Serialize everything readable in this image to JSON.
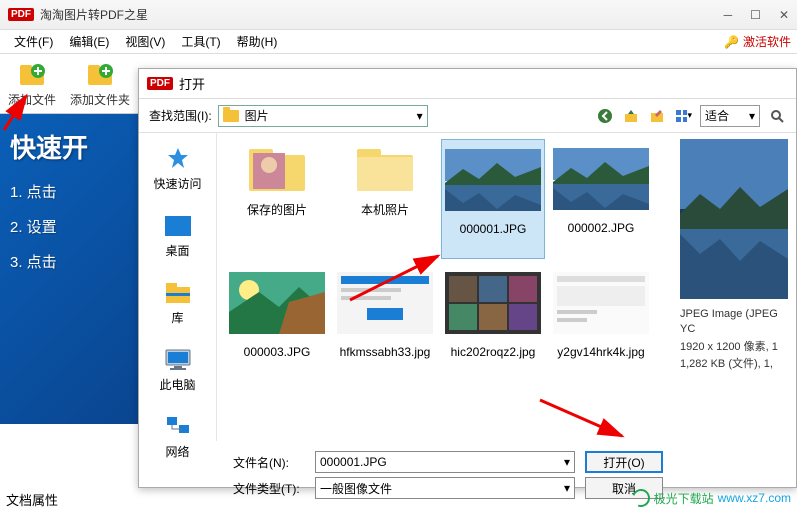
{
  "window": {
    "title": "淘淘图片转PDF之星",
    "badge": "PDF"
  },
  "menubar": {
    "file": "文件(F)",
    "edit": "编辑(E)",
    "view": "视图(V)",
    "tools": "工具(T)",
    "help": "帮助(H)",
    "activate": "激活软件"
  },
  "toolbar": {
    "add_file": "添加文件",
    "add_folder": "添加文件夹"
  },
  "quick_start": {
    "title": "快速开",
    "steps": [
      "1. 点击",
      "2. 设置",
      "3. 点击"
    ]
  },
  "doc_props": "文档属性",
  "dialog": {
    "title": "打开",
    "badge": "PDF",
    "lookup_label": "查找范围(I):",
    "lookup_value": "图片",
    "fit_label": "适合",
    "places": {
      "quick": "快速访问",
      "desktop": "桌面",
      "library": "库",
      "pc": "此电脑",
      "network": "网络"
    },
    "files": [
      {
        "name": "保存的图片",
        "type": "folder"
      },
      {
        "name": "本机照片",
        "type": "folder"
      },
      {
        "name": "000001.JPG",
        "type": "image",
        "variant": "lake",
        "selected": true
      },
      {
        "name": "000002.JPG",
        "type": "image",
        "variant": "lake"
      },
      {
        "name": "000003.JPG",
        "type": "image",
        "variant": "nature"
      },
      {
        "name": "hfkmssabh33.jpg",
        "type": "image",
        "variant": "ui1"
      },
      {
        "name": "hic202roqz2.jpg",
        "type": "image",
        "variant": "ui2"
      },
      {
        "name": "y2gv14hrk4k.jpg",
        "type": "image",
        "variant": "ui3"
      }
    ],
    "preview": {
      "kind": "JPEG Image (JPEG YC",
      "dims": "1920 x 1200 像素, 1",
      "size": "1,282 KB (文件), 1,"
    },
    "filename_label": "文件名(N):",
    "filename_value": "000001.JPG",
    "filetype_label": "文件类型(T):",
    "filetype_value": "一般图像文件",
    "open_btn": "打开(O)",
    "cancel_btn": "取消"
  },
  "watermark": {
    "name": "极光下载站",
    "site": "www.xz7.com"
  }
}
